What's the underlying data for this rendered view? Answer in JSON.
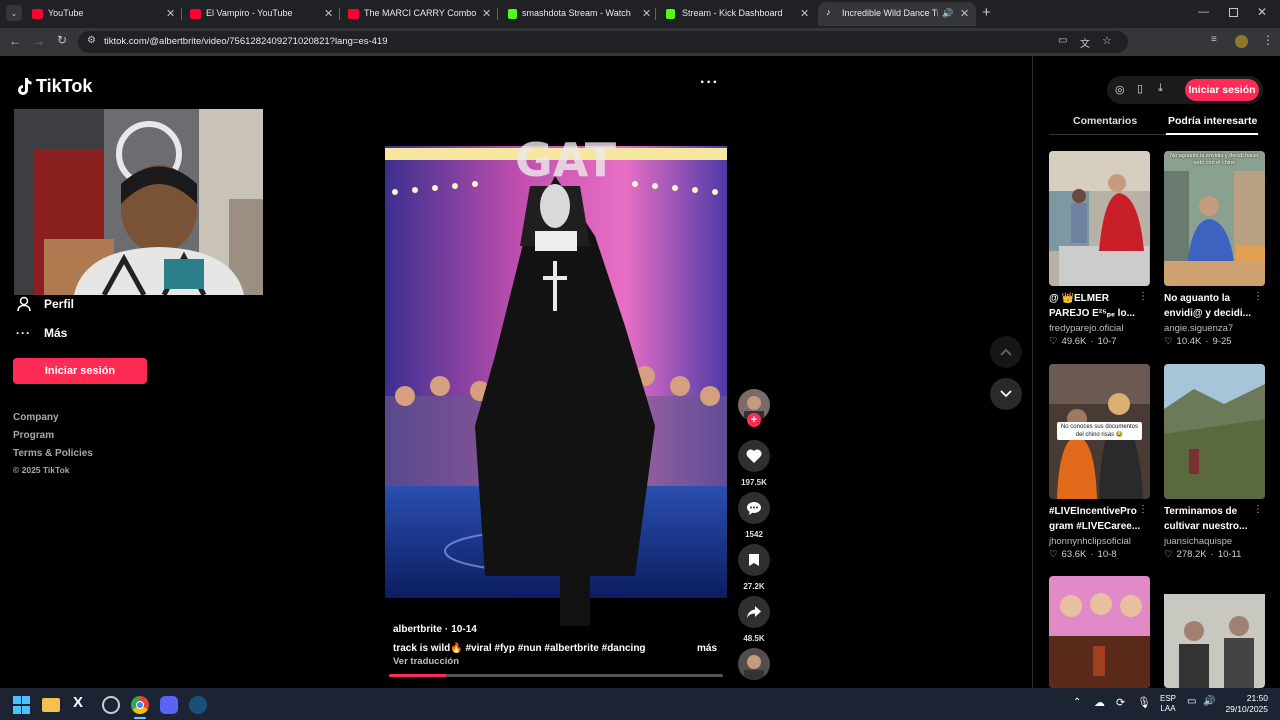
{
  "browser": {
    "tabs": [
      {
        "title": "YouTube",
        "favicon_color": "#ff0033"
      },
      {
        "title": "El Vampiro - YouTube",
        "favicon_color": "#ff0033"
      },
      {
        "title": "The MARCI CARRY Combo Tha",
        "favicon_color": "#ff0033"
      },
      {
        "title": "smashdota Stream - Watch Live",
        "favicon_color": "#53fc18"
      },
      {
        "title": "Stream - Kick Dashboard",
        "favicon_color": "#53fc18"
      },
      {
        "title": "Incredible Wild Dance Track",
        "favicon_color": "#ffffff"
      }
    ],
    "url": "tiktok.com/@albertbrite/video/7561282409271020821?lang=es-419"
  },
  "tiktok": {
    "logo": "TikTok",
    "sidebar": {
      "profile_label": "Perfil",
      "more_label": "Más",
      "login_label": "Iniciar sesión",
      "footer": {
        "company": "Company",
        "program": "Program",
        "terms": "Terms & Policies",
        "copyright": "© 2025 TikTok"
      }
    },
    "video": {
      "author": "albertbrite",
      "date": "10-14",
      "caption": "track is wild🔥 #viral #fyp #nun #albertbrite #dancing",
      "more": "más",
      "translate": "Ver traducción",
      "progress": 0.17
    },
    "actions": {
      "likes": "197.5K",
      "comments": "1542",
      "saves": "27.2K",
      "shares": "48.5K"
    },
    "right_panel": {
      "login_label": "Iniciar sesión",
      "tab_comments": "Comentarios",
      "tab_suggested": "Podría interesarte",
      "cards": [
        {
          "caption": "@ 👑ELMER PAREJO E²⁵ₚₑ lo...",
          "user": "fredyparejo.oficial",
          "likes": "49.6K",
          "date": "10-7"
        },
        {
          "caption": "No aguanto la envidi@ y decidi...",
          "user": "angie.siguenza7",
          "likes": "10.4K",
          "date": "9-25"
        },
        {
          "caption": "#LIVEIncentivePro gram #LIVECaree...",
          "user": "jhonnynhclipsoficial",
          "likes": "63.6K",
          "date": "10-8"
        },
        {
          "caption": "Terminamos de cultivar nuestro...",
          "user": "juansichaquispe",
          "likes": "278.2K",
          "date": "10-11"
        }
      ],
      "overlay_texts": {
        "card2": "No aguanto la envidia y decidi hacer esto con el chino",
        "card3": "No conoces sus documentos del chino risas 😂"
      }
    }
  },
  "taskbar": {
    "lang_top": "ESP",
    "lang_bottom": "LAA",
    "time": "21:50",
    "date": "29/10/2025"
  },
  "colors": {
    "tiktok_pink": "#fe2c55",
    "chrome_dark": "#202124",
    "chrome_bar": "#35363a",
    "taskbar": "#1c2433"
  }
}
